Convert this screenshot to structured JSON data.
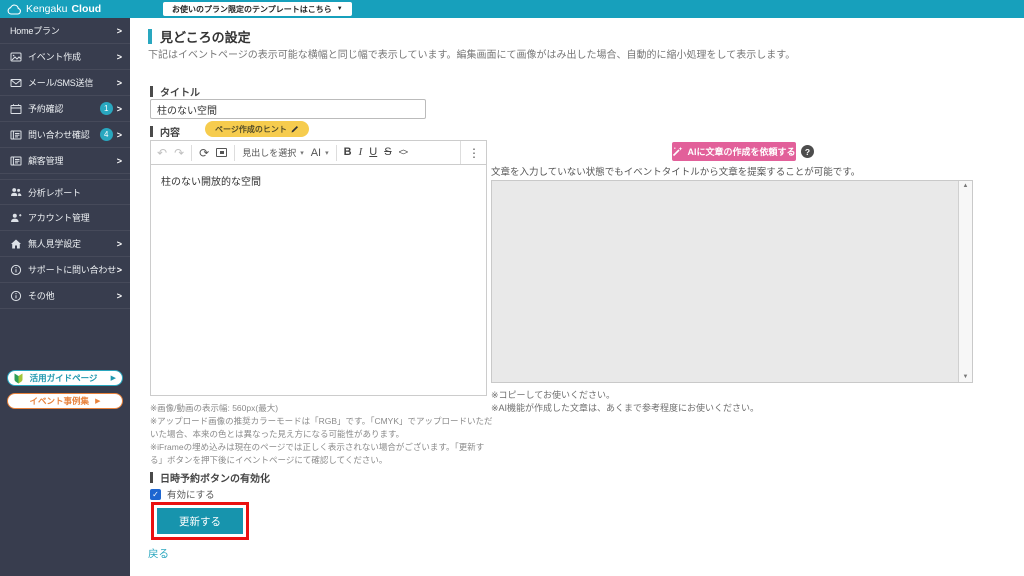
{
  "colors": {
    "topbar_teal": "#17a0bc",
    "sidebar_navy": "#383d4e",
    "badge_teal": "#29a7bf",
    "button_teal": "#1794ad",
    "pink": "#e2609a",
    "hint_yellow": "#f6cc4e",
    "annotation_red": "#ea1010",
    "orange": "#e8823c",
    "checkbox_blue": "#1e66d0"
  },
  "icons": {
    "template_dropdown": "▼",
    "pill_arrow": "▶",
    "dropdown_caret": "▾",
    "chevron": ">",
    "undo": "↶",
    "redo": "↷",
    "reload": "⟳",
    "more": "⋮",
    "help": "?",
    "check": "✓",
    "scroll_up": "▲",
    "scroll_down": "▼"
  },
  "topbar": {
    "logo_text": "Kengaku",
    "logo_bold": "Cloud",
    "template_button": "お使いのプラン限定のテンプレートはこちら"
  },
  "sidebar": {
    "items": [
      {
        "label": "Homeプラン"
      },
      {
        "label": "イベント作成"
      },
      {
        "label": "メール/SMS送信"
      },
      {
        "label": "予約確認",
        "badge": "1"
      },
      {
        "label": "問い合わせ確認",
        "badge": "4"
      },
      {
        "label": "顧客管理"
      },
      {
        "label": "分析レポート"
      },
      {
        "label": "アカウント管理"
      },
      {
        "label": "無人見学設定"
      },
      {
        "label": "サポートに問い合わせ"
      },
      {
        "label": "その他"
      }
    ],
    "guide_button": "活用ガイドページ",
    "case_button": "イベント事例集"
  },
  "main": {
    "page_title": "見どころの設定",
    "subtitle": "下記はイベントページの表示可能な横幅と同じ幅で表示しています。編集画面にて画像がはみ出した場合、自動的に縮小処理をして表示します。",
    "title_label": "タイトル",
    "title_value": "柱のない空間",
    "content_label": "内容",
    "hint_badge": "ページ作成のヒント",
    "editor": {
      "heading_select": "見出しを選択",
      "ai_menu": "AI",
      "bold": "B",
      "italic": "I",
      "underline": "U",
      "strike": "S",
      "code": "<>",
      "content": "柱のない開放的な空間"
    },
    "notes_left": [
      "※画像/動画の表示幅: 560px(最大)",
      "※アップロード画像の推奨カラーモードは「RGB」です。「CMYK」でアップロードいただいた場合、本来の色とは異なった見え方になる可能性があります。",
      "※iFrameの埋め込みは現在のページでは正しく表示されない場合がございます。「更新する」ボタンを押下後にイベントページにて確認してください。"
    ],
    "booking_label": "日時予約ボタンの有効化",
    "checkbox_label": "有効にする",
    "update_button": "更新する",
    "back_link": "戻る"
  },
  "ai_panel": {
    "request_button": "AIに文章の作成を依頼する",
    "hint": "文章を入力していない状態でもイベントタイトルから文章を提案することが可能です。",
    "notes": [
      "※コピーしてお使いください。",
      "※AI機能が作成した文章は、あくまで参考程度にお使いください。"
    ]
  }
}
